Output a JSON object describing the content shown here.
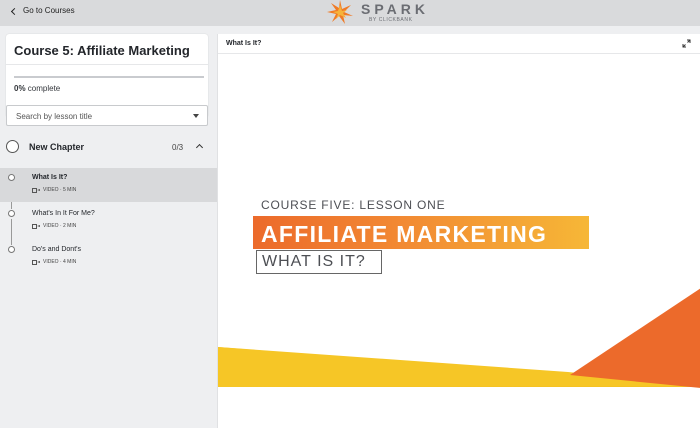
{
  "topbar": {
    "back_label": "Go to Courses",
    "brand_name": "SPARK",
    "brand_sub": "BY CLICKBANK"
  },
  "course": {
    "title": "Course 5: Affiliate Marketing",
    "progress_percent": 0,
    "progress_value": "0%",
    "progress_suffix": "complete"
  },
  "search": {
    "placeholder": "Search by lesson title"
  },
  "chapter": {
    "title": "New Chapter",
    "count": "0/3"
  },
  "lessons": [
    {
      "title": "What Is It?",
      "meta": "VIDEO · 5 MIN",
      "active": true
    },
    {
      "title": "What's In It For Me?",
      "meta": "VIDEO · 2 MIN",
      "active": false
    },
    {
      "title": "Do's and Dont's",
      "meta": "VIDEO · 4 MIN",
      "active": false
    }
  ],
  "main": {
    "header_title": "What Is It?"
  },
  "slide": {
    "kicker": "COURSE FIVE: LESSON ONE",
    "headline": "AFFILIATE MARKETING",
    "subhead": "WHAT IS IT?"
  },
  "colors": {
    "orange": "#ec6a2b",
    "yellow": "#f5c122",
    "accent_dark_orange": "#e8702a"
  }
}
